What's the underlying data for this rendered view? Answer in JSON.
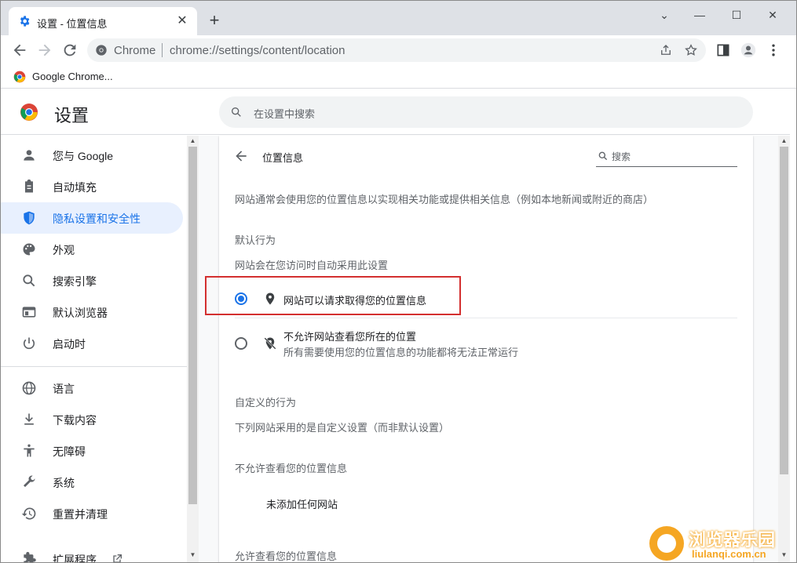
{
  "tab": {
    "title": "设置 - 位置信息",
    "close": "✕",
    "new_tab": "+"
  },
  "window_controls": {
    "dropdown": "⌄",
    "minimize": "—",
    "maximize": "☐",
    "close": "✕"
  },
  "omnibox": {
    "site_name": "Chrome",
    "url": "chrome://settings/content/location"
  },
  "bookmarks": [
    {
      "label": "Google Chrome..."
    }
  ],
  "header": {
    "title": "设置",
    "search_placeholder": "在设置中搜索"
  },
  "sidebar": {
    "items": [
      {
        "label": "您与 Google",
        "icon": "person-icon"
      },
      {
        "label": "自动填充",
        "icon": "clipboard-icon"
      },
      {
        "label": "隐私设置和安全性",
        "icon": "shield-icon",
        "active": true
      },
      {
        "label": "外观",
        "icon": "palette-icon"
      },
      {
        "label": "搜索引擎",
        "icon": "search-icon"
      },
      {
        "label": "默认浏览器",
        "icon": "browser-icon"
      },
      {
        "label": "启动时",
        "icon": "power-icon"
      },
      {
        "label": "语言",
        "icon": "globe-icon"
      },
      {
        "label": "下载内容",
        "icon": "download-icon"
      },
      {
        "label": "无障碍",
        "icon": "accessibility-icon"
      },
      {
        "label": "系统",
        "icon": "wrench-icon"
      },
      {
        "label": "重置并清理",
        "icon": "history-icon"
      },
      {
        "label": "扩展程序",
        "icon": "puzzle-icon"
      }
    ]
  },
  "page": {
    "heading": "位置信息",
    "search_label": "搜索",
    "description": "网站通常会使用您的位置信息以实现相关功能或提供相关信息（例如本地新闻或附近的商店）",
    "default_behavior": {
      "title": "默认行为",
      "subtitle": "网站会在您访问时自动采用此设置",
      "options": [
        {
          "label": "网站可以请求取得您的位置信息",
          "checked": true
        },
        {
          "label": "不允许网站查看您所在的位置",
          "sub": "所有需要使用您的位置信息的功能都将无法正常运行",
          "checked": false
        }
      ]
    },
    "custom_behavior": {
      "title": "自定义的行为",
      "subtitle": "下列网站采用的是自定义设置（而非默认设置）"
    },
    "blocked": {
      "title": "不允许查看您的位置信息",
      "empty": "未添加任何网站"
    },
    "allowed": {
      "title": "允许查看您的位置信息"
    }
  },
  "watermark": {
    "title": "浏览器乐园",
    "url": "liulanqi.com.cn"
  },
  "colors": {
    "accent": "#1a73e8",
    "highlight": "#d32f2f",
    "watermark": "#f5a623"
  }
}
